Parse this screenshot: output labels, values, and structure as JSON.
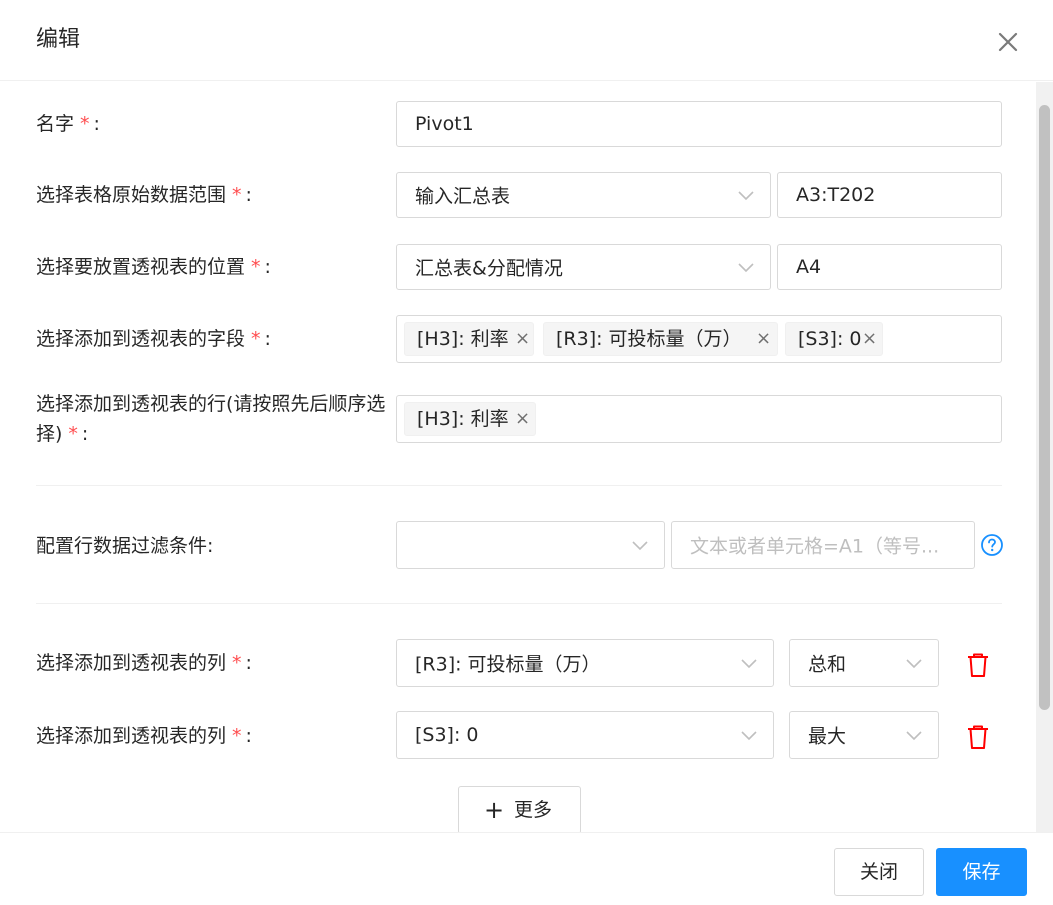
{
  "modal": {
    "title": "编辑",
    "close_icon": "close-icon"
  },
  "form": {
    "name": {
      "label": "名字",
      "value": "Pivot1"
    },
    "source_range": {
      "label": "选择表格原始数据范围",
      "sheet": "输入汇总表",
      "range": "A3:T202"
    },
    "target_position": {
      "label": "选择要放置透视表的位置",
      "sheet": "汇总表&分配情况",
      "cell": "A4"
    },
    "fields": {
      "label": "选择添加到透视表的字段",
      "tags": [
        "[H3]: 利率",
        "[R3]: 可投标量（万）",
        "[S3]: 0"
      ]
    },
    "rows": {
      "label": "选择添加到透视表的行(请按照先后顺序选择)",
      "tags": [
        "[H3]: 利率"
      ]
    },
    "filter": {
      "label": "配置行数据过滤条件:",
      "select_value": "",
      "condition_placeholder": "文本或者单元格=A1（等号..."
    },
    "columns": [
      {
        "label": "选择添加到透视表的列",
        "field": "[R3]: 可投标量（万）",
        "aggregate": "总和"
      },
      {
        "label": "选择添加到透视表的列",
        "field": "[S3]: 0",
        "aggregate": "最大"
      }
    ],
    "required_mark": "*",
    "colon": ":",
    "more_button": {
      "icon": "plus-icon",
      "label": "更多"
    }
  },
  "footer": {
    "close_label": "关闭",
    "save_label": "保存"
  },
  "colors": {
    "primary": "#1890ff",
    "required": "#ff4d4f",
    "danger": "#ff0000",
    "help": "#1890ff"
  }
}
